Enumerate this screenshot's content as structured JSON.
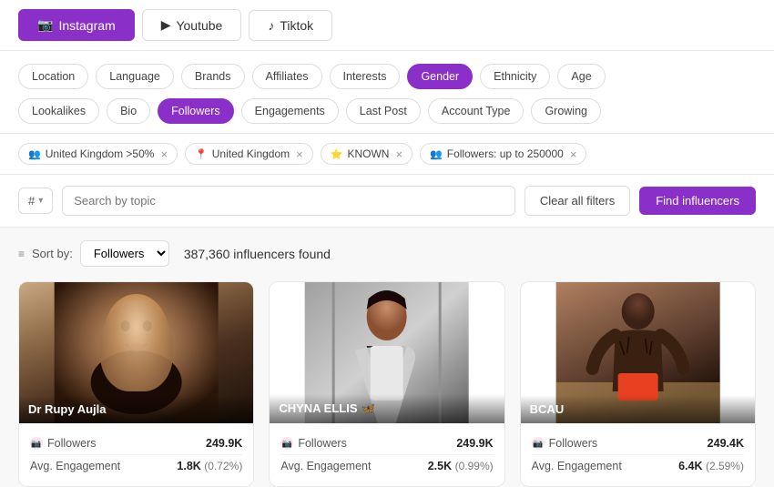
{
  "platform_tabs": [
    {
      "id": "instagram",
      "label": "Instagram",
      "icon": "📷",
      "active": true
    },
    {
      "id": "youtube",
      "label": "Youtube",
      "icon": "▶",
      "active": false
    },
    {
      "id": "tiktok",
      "label": "Tiktok",
      "icon": "♪",
      "active": false
    }
  ],
  "filter_row1": [
    {
      "id": "location",
      "label": "Location",
      "active": false
    },
    {
      "id": "language",
      "label": "Language",
      "active": false
    },
    {
      "id": "brands",
      "label": "Brands",
      "active": false
    },
    {
      "id": "affiliates",
      "label": "Affiliates",
      "active": false
    },
    {
      "id": "interests",
      "label": "Interests",
      "active": false
    },
    {
      "id": "gender",
      "label": "Gender",
      "active": true
    },
    {
      "id": "ethnicity",
      "label": "Ethnicity",
      "active": false
    },
    {
      "id": "age",
      "label": "Age",
      "active": false
    }
  ],
  "filter_row2": [
    {
      "id": "lookalikes",
      "label": "Lookalikes",
      "active": false
    },
    {
      "id": "bio",
      "label": "Bio",
      "active": false
    },
    {
      "id": "followers",
      "label": "Followers",
      "active": true
    },
    {
      "id": "engagements",
      "label": "Engagements",
      "active": false
    },
    {
      "id": "last_post",
      "label": "Last Post",
      "active": false
    },
    {
      "id": "account_type",
      "label": "Account Type",
      "active": false
    },
    {
      "id": "growing",
      "label": "Growing",
      "active": false
    }
  ],
  "active_filter_tags": [
    {
      "id": "uk_audience",
      "icon": "👥",
      "label": "United Kingdom >50%"
    },
    {
      "id": "uk_location",
      "icon": "📍",
      "label": "United Kingdom"
    },
    {
      "id": "known",
      "icon": "⭐",
      "label": "KNOWN"
    },
    {
      "id": "followers_range",
      "icon": "👥",
      "label": "Followers: up to 250000"
    }
  ],
  "search": {
    "topic_selector_label": "#",
    "placeholder": "Search by topic",
    "clear_btn": "Clear all filters",
    "find_btn": "Find influencers"
  },
  "results": {
    "sort_label": "Sort by:",
    "sort_option": "Followers",
    "sort_icon": "≡",
    "count_text": "387,360 influencers found"
  },
  "influencer_cards": [
    {
      "id": "card1",
      "name": "Dr Rupy Aujla",
      "bg_class": "card-bg-1",
      "followers_label": "Followers",
      "followers_value": "249.9K",
      "engagement_label": "Avg. Engagement",
      "engagement_value": "1.8K",
      "engagement_percent": "(0.72%)"
    },
    {
      "id": "card2",
      "name": "CHYNA ELLIS 🦋",
      "bg_class": "card-bg-2",
      "followers_label": "Followers",
      "followers_value": "249.9K",
      "engagement_label": "Avg. Engagement",
      "engagement_value": "2.5K",
      "engagement_percent": "(0.99%)"
    },
    {
      "id": "card3",
      "name": "BCAU",
      "bg_class": "card-bg-3",
      "followers_label": "Followers",
      "followers_value": "249.4K",
      "engagement_label": "Avg. Engagement",
      "engagement_value": "6.4K",
      "engagement_percent": "(2.59%)"
    }
  ],
  "colors": {
    "primary": "#8b2fc9",
    "primary_light": "#f3e5fd"
  }
}
